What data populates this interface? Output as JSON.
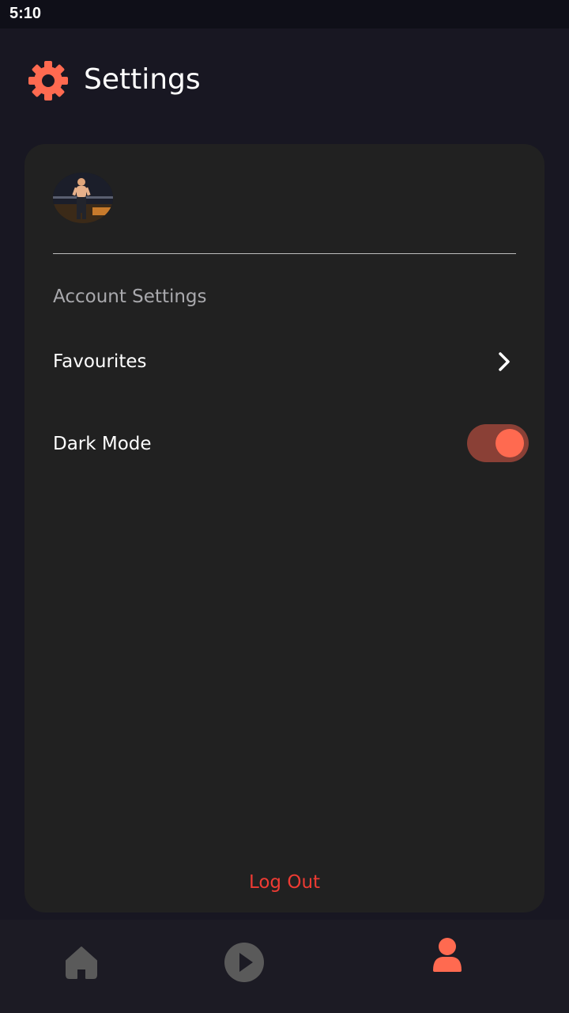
{
  "status_bar": {
    "time": "5:10"
  },
  "header": {
    "title": "Settings",
    "icon": "gear-icon",
    "accent": "#ff6a50"
  },
  "profile": {
    "avatar": "avatar"
  },
  "section": {
    "title": "Account Settings"
  },
  "rows": {
    "favourites": {
      "label": "Favourites",
      "icon": "chevron-right-icon"
    },
    "dark_mode": {
      "label": "Dark Mode",
      "enabled": true
    }
  },
  "logout": {
    "label": "Log Out",
    "color": "#ee3b33"
  },
  "bottom_nav": {
    "items": [
      {
        "name": "home",
        "icon": "home-icon",
        "active": false
      },
      {
        "name": "play",
        "icon": "play-icon",
        "active": false
      },
      {
        "name": "profile",
        "icon": "person-icon",
        "active": true
      }
    ],
    "active_color": "#ff6a50",
    "inactive_color": "#5a5a5a"
  }
}
